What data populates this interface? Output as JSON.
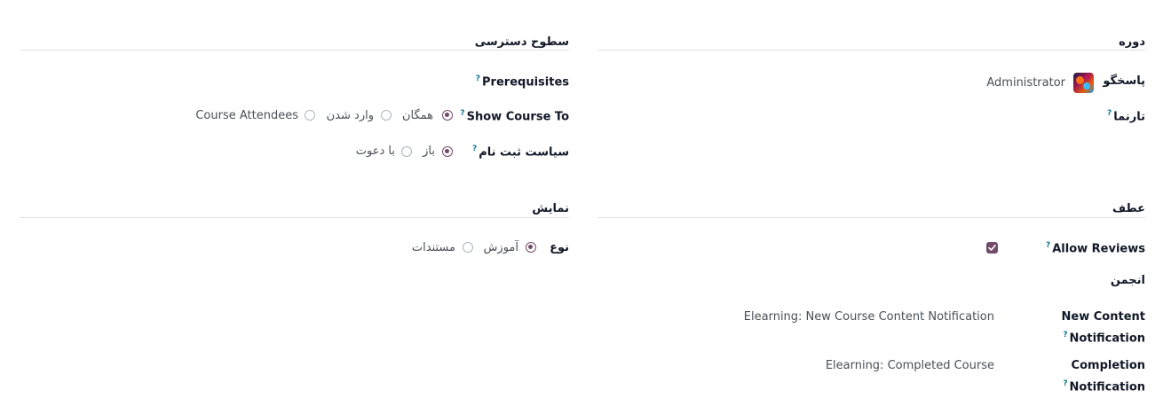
{
  "course_section": {
    "title": "دوره",
    "responsible_label": "پاسخگو",
    "responsible_value": "Administrator",
    "website_label": "تارنما"
  },
  "access_section": {
    "title": "سطوح دسترسی",
    "prerequisites_label": "Prerequisites",
    "show_course_to_label": "Show Course To",
    "show_options": [
      "همگان",
      "وارد شدن",
      "Course Attendees"
    ],
    "show_selected": "همگان",
    "enroll_policy_label": "سیاست ثبت نام",
    "enroll_options": [
      "باز",
      "با دعوت"
    ],
    "enroll_selected": "باز"
  },
  "display_section": {
    "title": "نمایش",
    "type_label": "نوع",
    "type_options": [
      "آموزش",
      "مستندات"
    ],
    "type_selected": "آموزش"
  },
  "karma_section": {
    "title": "عطف",
    "allow_reviews_label": "Allow Reviews",
    "allow_reviews_checked": true,
    "forum_label": "انجمن",
    "new_content_label_1": "New Content",
    "new_content_label_2": "Notification",
    "new_content_value": "Elearning: New Course Content Notification",
    "completion_label_1": "Completion",
    "completion_label_2": "Notification",
    "completion_value": "Elearning: Completed Course"
  },
  "help_marker": "?",
  "colors": {
    "accent": "#714B67",
    "help": "#0e7490",
    "rule": "#dee2e6"
  }
}
